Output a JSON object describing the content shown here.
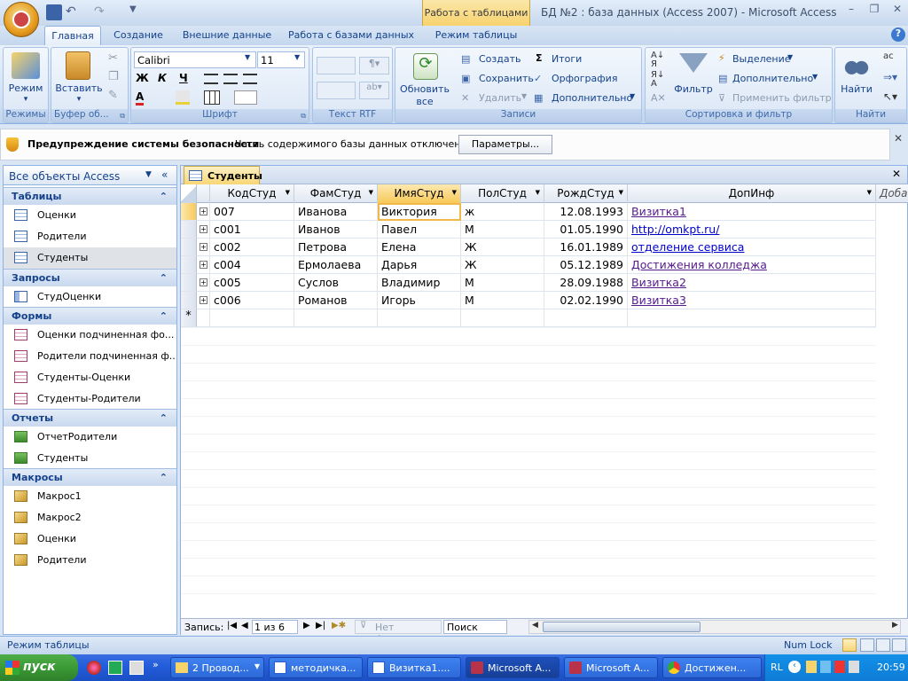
{
  "title": {
    "context_tab": "Работа с таблицами",
    "text": "БД №2 : база данных (Access 2007) - Microsoft Access"
  },
  "tabs": [
    "Главная",
    "Создание",
    "Внешние данные",
    "Работа с базами данных",
    "Режим таблицы"
  ],
  "ribbon": {
    "groups": {
      "views": "Режимы",
      "clipboard": "Буфер об...",
      "font": "Шрифт",
      "rtf": "Текст RTF",
      "records": "Записи",
      "sortfilter": "Сортировка и фильтр",
      "find": "Найти"
    },
    "view_btn": "Режим",
    "paste_btn": "Вставить",
    "font_name": "Calibri",
    "font_size": "11",
    "refresh_btn_1": "Обновить",
    "refresh_btn_2": "все",
    "rec_create": "Создать",
    "rec_save": "Сохранить",
    "rec_delete": "Удалить",
    "rec_totals": "Итоги",
    "rec_spelling": "Орфография",
    "rec_more": "Дополнительно",
    "filter_btn": "Фильтр",
    "sel_btn": "Выделение",
    "adv_btn": "Дополнительно",
    "apply_btn": "Применить фильтр",
    "find_btn": "Найти"
  },
  "security": {
    "title": "Предупреждение системы безопасности",
    "message": "Часть содержимого базы данных отключено",
    "button": "Параметры..."
  },
  "nav": {
    "header": "Все объекты Access",
    "sections": [
      {
        "title": "Таблицы",
        "items": [
          "Оценки",
          "Родители",
          "Студенты"
        ]
      },
      {
        "title": "Запросы",
        "items": [
          "СтудОценки"
        ]
      },
      {
        "title": "Формы",
        "items": [
          "Оценки подчиненная фо...",
          "Родители подчиненная ф...",
          "Студенты-Оценки",
          "Студенты-Родители"
        ]
      },
      {
        "title": "Отчеты",
        "items": [
          "ОтчетРодители",
          "Студенты"
        ]
      },
      {
        "title": "Макросы",
        "items": [
          "Макрос1",
          "Макрос2",
          "Оценки",
          "Родители"
        ]
      }
    ]
  },
  "doc_tab": "Студенты",
  "grid": {
    "columns": [
      "КодСтуд",
      "ФамСтуд",
      "ИмяСтуд",
      "ПолСтуд",
      "РождСтуд",
      "ДопИнф",
      "Доба"
    ],
    "rows": [
      [
        "007",
        "Иванова",
        "Виктория",
        "ж",
        "12.08.1993",
        "Визитка1"
      ],
      [
        "с001",
        "Иванов",
        "Павел",
        "М",
        "01.05.1990",
        "http://omkpt.ru/"
      ],
      [
        "с002",
        "Петрова",
        "Елена",
        "Ж",
        "16.01.1989",
        "отделение сервиса"
      ],
      [
        "с004",
        "Ермолаева",
        "Дарья",
        "Ж",
        "05.12.1989",
        "Достижения колледжа"
      ],
      [
        "с005",
        "Суслов",
        "Владимир",
        "М",
        "28.09.1988",
        "Визитка2"
      ],
      [
        "с006",
        "Романов",
        "Игорь",
        "М",
        "02.02.1990",
        "Визитка3"
      ]
    ],
    "new_row_marker": "*"
  },
  "recbar": {
    "label": "Запись:",
    "position": "1 из 6",
    "no_filter": "Нет фильтра",
    "search": "Поиск"
  },
  "status": {
    "left": "Режим таблицы",
    "right": "Num Lock"
  },
  "taskbar": {
    "start": "пуск",
    "tasks": [
      "2 Провод...",
      "методичка...",
      "Визитка1....",
      "Microsoft A...",
      "Microsoft A...",
      "Достижен..."
    ],
    "lang": "RL",
    "clock": "20:59"
  },
  "colors": {
    "accent": "#15428b",
    "ribbon": "#dbe7f6",
    "taskbar": "#245edb",
    "link_visited": "#551a8b",
    "link": "#0000cc"
  }
}
